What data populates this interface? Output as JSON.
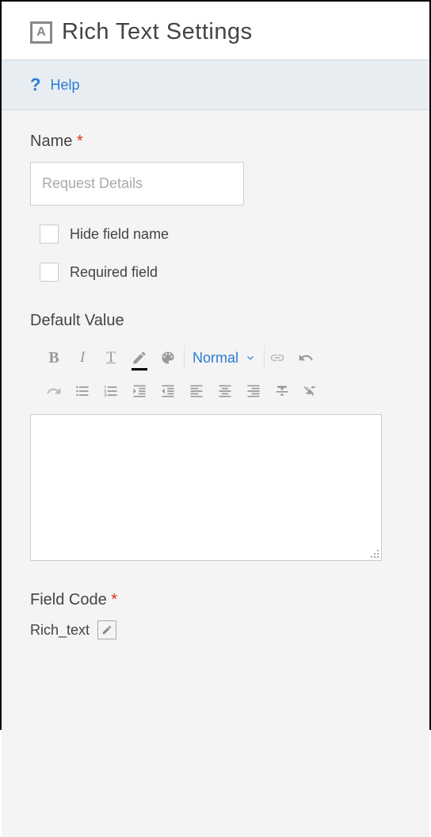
{
  "header": {
    "icon_letter": "A",
    "title": "Rich Text Settings"
  },
  "help": {
    "label": "Help"
  },
  "fields": {
    "name": {
      "label": "Name",
      "required_mark": "*",
      "value": "Request Details"
    },
    "hide_field_name": {
      "label": "Hide field name"
    },
    "required_field": {
      "label": "Required field"
    },
    "default_value": {
      "label": "Default Value"
    },
    "field_code": {
      "label": "Field Code",
      "required_mark": "*",
      "value": "Rich_text"
    }
  },
  "toolbar": {
    "bold": "B",
    "italic": "I",
    "underline": "T",
    "format_label": "Normal"
  }
}
